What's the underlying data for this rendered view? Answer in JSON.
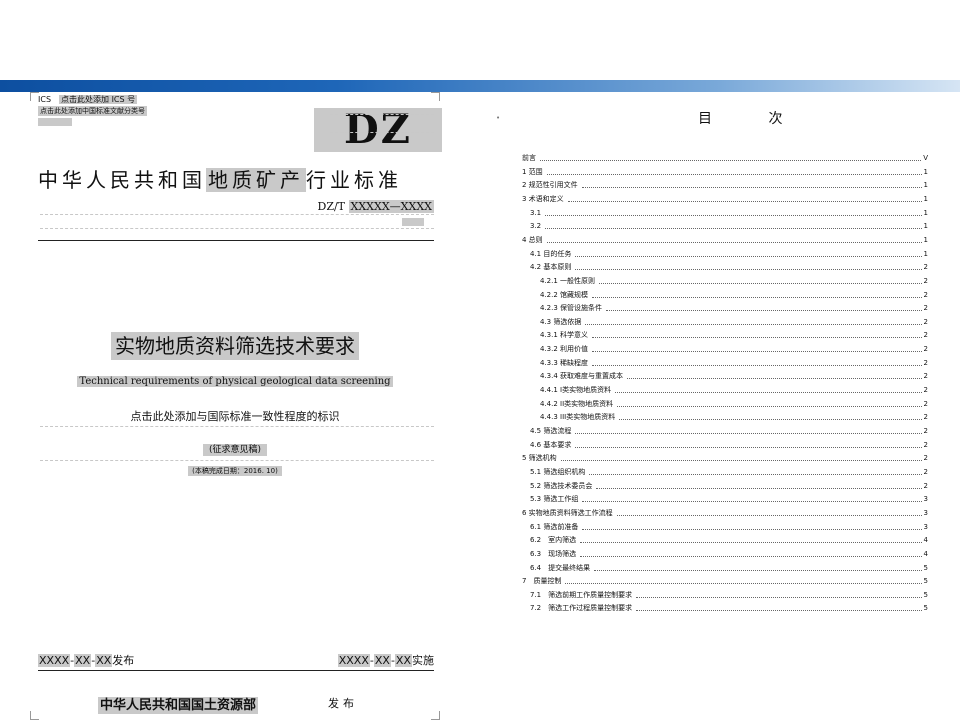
{
  "cover": {
    "ics_label": "ICS",
    "ics_placeholder": "点击此处添加 ICS 号",
    "std_class_placeholder": "点击此处添加中国标准文献分类号",
    "logo": "DZ",
    "std_prefix": "中华人民共和国",
    "std_field": "地质矿产",
    "std_suffix": "行业标准",
    "std_code_prefix": "DZ/T",
    "std_code_value": "XXXXX—XXXX",
    "title_cn": "实物地质资料筛选技术要求",
    "title_en": "Technical requirements of physical geological data screening",
    "identity_placeholder": "点击此处添加与国际标准一致性程度的标识",
    "draft_label": "(征求意见稿)",
    "completion_date": "(本稿完成日期：2016. 10)",
    "publish_date": {
      "y": "XXXX",
      "sep1": "-",
      "m": "XX",
      "sep2": "-",
      "d": "XX",
      "label": "发布"
    },
    "implement_date": {
      "y": "XXXX",
      "sep1": "-",
      "m": "XX",
      "sep2": "-",
      "d": "XX",
      "label": "实施"
    },
    "ministry": "中华人民共和国国土资源部",
    "publish_word": "发布"
  },
  "toc": {
    "marker": "•",
    "title": "目 次",
    "entries": [
      {
        "label": "前言",
        "page": "V",
        "indent": 0
      },
      {
        "label": "1 范围",
        "page": "1",
        "indent": 0
      },
      {
        "label": "2 规范性引用文件",
        "page": "1",
        "indent": 0
      },
      {
        "label": "3 术语和定义",
        "page": "1",
        "indent": 0
      },
      {
        "label": "3.1",
        "page": "1",
        "indent": 1
      },
      {
        "label": "3.2",
        "page": "1",
        "indent": 1
      },
      {
        "label": "4 总则",
        "page": "1",
        "indent": 0
      },
      {
        "label": "4.1 目的任务",
        "page": "1",
        "indent": 1
      },
      {
        "label": "4.2 基本原则",
        "page": "2",
        "indent": 1
      },
      {
        "label": "4.2.1 一般性原则",
        "page": "2",
        "indent": 2
      },
      {
        "label": "4.2.2 馆藏规模",
        "page": "2",
        "indent": 2
      },
      {
        "label": "4.2.3 保管设施条件",
        "page": "2",
        "indent": 2
      },
      {
        "label": "4.3 筛选依据",
        "page": "2",
        "indent": 2
      },
      {
        "label": "4.3.1 科学意义",
        "page": "2",
        "indent": 2
      },
      {
        "label": "4.3.2 利用价值",
        "page": "2",
        "indent": 2
      },
      {
        "label": "4.3.3 稀缺程度",
        "page": "2",
        "indent": 2
      },
      {
        "label": "4.3.4 获取难度与重置成本",
        "page": "2",
        "indent": 2
      },
      {
        "label": "4.4.1 I类实物地质资料",
        "page": "2",
        "indent": 2
      },
      {
        "label": "4.4.2 II类实物地质资料",
        "page": "2",
        "indent": 2
      },
      {
        "label": "4.4.3 III类实物地质资料",
        "page": "2",
        "indent": 2
      },
      {
        "label": "4.5 筛选流程",
        "page": "2",
        "indent": 1
      },
      {
        "label": "4.6 基本要求",
        "page": "2",
        "indent": 1
      },
      {
        "label": "5 筛选机构",
        "page": "2",
        "indent": 0
      },
      {
        "label": "5.1 筛选组织机构",
        "page": "2",
        "indent": 1
      },
      {
        "label": "5.2 筛选技术委员会",
        "page": "2",
        "indent": 1
      },
      {
        "label": "5.3 筛选工作组",
        "page": "3",
        "indent": 1
      },
      {
        "label": "6 实物地质资料筛选工作流程",
        "page": "3",
        "indent": 0
      },
      {
        "label": "6.1 筛选前准备",
        "page": "3",
        "indent": 1
      },
      {
        "label": "6.2　室内筛选",
        "page": "4",
        "indent": 1
      },
      {
        "label": "6.3　现场筛选",
        "page": "4",
        "indent": 1
      },
      {
        "label": "6.4　提交最终结果",
        "page": "5",
        "indent": 1
      },
      {
        "label": "7　质量控制",
        "page": "5",
        "indent": 0
      },
      {
        "label": "7.1　筛选前期工作质量控制要求",
        "page": "5",
        "indent": 1
      },
      {
        "label": "7.2　筛选工作过程质量控制要求",
        "page": "5",
        "indent": 1
      }
    ]
  }
}
